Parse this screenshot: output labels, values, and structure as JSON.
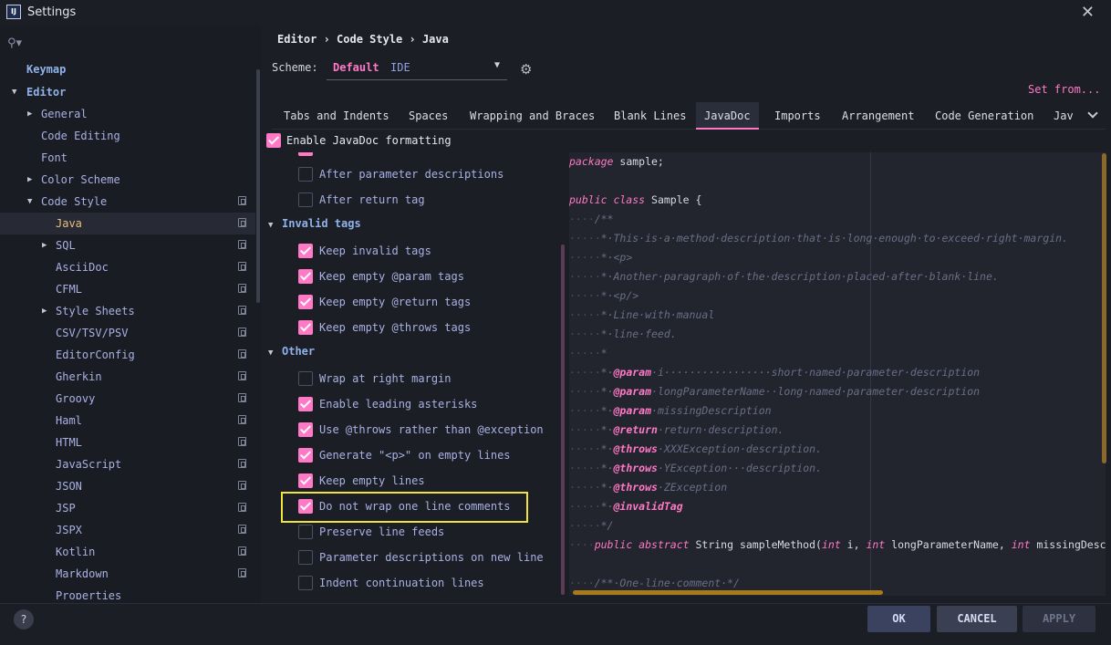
{
  "window": {
    "title": "Settings",
    "logo": "IJ"
  },
  "breadcrumb": {
    "text": "Editor › Code Style › Java"
  },
  "scheme": {
    "label": "Scheme:",
    "name": "Default",
    "scope": "IDE"
  },
  "set_from": "Set from...",
  "sidebar": {
    "items": [
      {
        "label": "Keymap"
      },
      {
        "label": "Editor"
      },
      {
        "label": "General"
      },
      {
        "label": "Code Editing"
      },
      {
        "label": "Font"
      },
      {
        "label": "Color Scheme"
      },
      {
        "label": "Code Style"
      },
      {
        "label": "Java"
      },
      {
        "label": "SQL"
      },
      {
        "label": "AsciiDoc"
      },
      {
        "label": "CFML"
      },
      {
        "label": "Style Sheets"
      },
      {
        "label": "CSV/TSV/PSV"
      },
      {
        "label": "EditorConfig"
      },
      {
        "label": "Gherkin"
      },
      {
        "label": "Groovy"
      },
      {
        "label": "Haml"
      },
      {
        "label": "HTML"
      },
      {
        "label": "JavaScript"
      },
      {
        "label": "JSON"
      },
      {
        "label": "JSP"
      },
      {
        "label": "JSPX"
      },
      {
        "label": "Kotlin"
      },
      {
        "label": "Markdown"
      },
      {
        "label": "Properties"
      }
    ]
  },
  "tabs": [
    "Tabs and Indents",
    "Spaces",
    "Wrapping and Braces",
    "Blank Lines",
    "JavaDoc",
    "Imports",
    "Arrangement",
    "Code Generation",
    "Jav"
  ],
  "active_tab": "JavaDoc",
  "options": {
    "enable": "Enable JavaDoc formatting",
    "after_param": "After parameter descriptions",
    "after_return": "After return tag",
    "invalid_tags": "Invalid tags",
    "keep_invalid": "Keep invalid tags",
    "keep_param": "Keep empty @param tags",
    "keep_return": "Keep empty @return tags",
    "keep_throws": "Keep empty @throws tags",
    "other": "Other",
    "wrap_margin": "Wrap at right margin",
    "leading_asterisks": "Enable leading asterisks",
    "use_throws": "Use @throws rather than @exception",
    "generate_p": "Generate \"<p>\" on empty lines",
    "keep_empty_lines": "Keep empty lines",
    "no_wrap_one_line": "Do not wrap one line comments",
    "preserve_feeds": "Preserve line feeds",
    "param_new_line": "Parameter descriptions on new line",
    "indent_continuation": "Indent continuation lines"
  },
  "colors": {
    "accent": "#ff79c6",
    "highlight_box": "#f0e33c"
  },
  "buttons": {
    "ok": "OK",
    "cancel": "CANCEL",
    "apply": "APPLY",
    "help": "?"
  }
}
